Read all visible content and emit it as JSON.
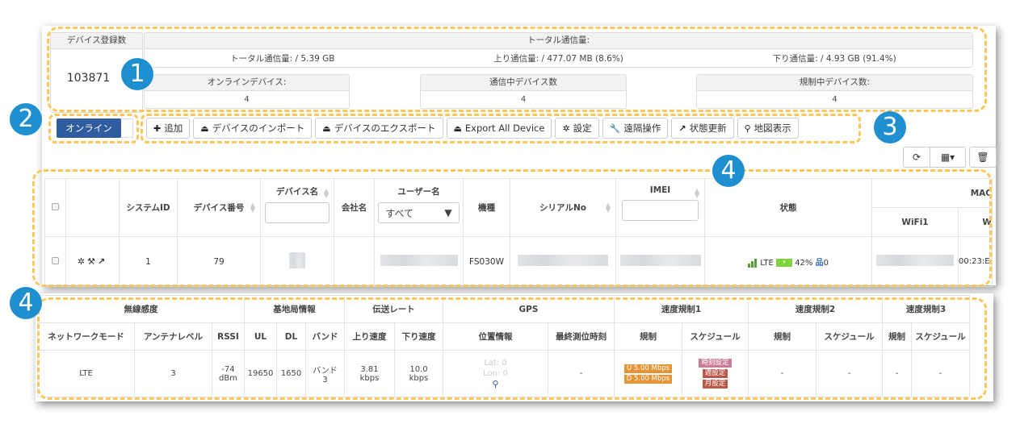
{
  "summary": {
    "registered_label": "デバイス登録数",
    "registered_value": "103871",
    "traffic_header": "トータル通信量:",
    "total": "トータル通信量: / 5.39 GB",
    "upload": "上り通信量: / 477.07 MB (8.6%)",
    "download": "下り通信量: / 4.93 GB (91.4%)",
    "online_label": "オンラインデバイス:",
    "online_value": "4",
    "communicating_label": "通信中デバイス数",
    "communicating_value": "4",
    "throttled_label": "規制中デバイス数:",
    "throttled_value": "4"
  },
  "filter": {
    "online_label": "オンライン"
  },
  "toolbar": [
    {
      "icon": "plus-icon",
      "glyph": "✚",
      "label": "追加"
    },
    {
      "icon": "import-icon",
      "glyph": "⏏",
      "label": "デバイスのインポート"
    },
    {
      "icon": "export-icon",
      "glyph": "⏏",
      "label": "デバイスのエクスポート"
    },
    {
      "icon": "export-all-icon",
      "glyph": "⏏",
      "label": "Export All Device"
    },
    {
      "icon": "gear-icon",
      "glyph": "✲",
      "label": "設定"
    },
    {
      "icon": "wrench-icon",
      "glyph": "🔧",
      "label": "遠隔操作"
    },
    {
      "icon": "external-link-icon",
      "glyph": "↗",
      "label": "状態更新"
    },
    {
      "icon": "map-marker-icon",
      "glyph": "⚲",
      "label": "地図表示"
    }
  ],
  "table_tools": {
    "refresh": "⟳",
    "columns": "▦▾",
    "delete": "🗑"
  },
  "devices_table": {
    "headers": {
      "system_id": "システムID",
      "device_no": "デバイス番号",
      "device_name": "デバイス名",
      "company": "会社名",
      "user_name": "ユーザー名",
      "user_filter": "すべて",
      "model": "機種",
      "serial": "シリアルNo",
      "imei": "IMEI",
      "status": "状態",
      "mac": "MAC",
      "wifi1": "WiFi1",
      "wifi2_partial": "W"
    },
    "rows": [
      {
        "system_id": "1",
        "device_no": "79",
        "model": "FS030W",
        "network": "LTE",
        "battery": "42%",
        "connections": "0",
        "mac_partial": "00:23:E"
      }
    ]
  },
  "detail_table": {
    "groups": [
      "無線感度",
      "基地局情報",
      "伝送レート",
      "GPS",
      "速度規制1",
      "速度規制2",
      "速度規制3"
    ],
    "headers": [
      "ネットワークモード",
      "アンテナレベル",
      "RSSI",
      "UL",
      "DL",
      "バンド",
      "上り速度",
      "下り速度",
      "位置情報",
      "最終測位時刻",
      "規制",
      "スケジュール",
      "規制",
      "スケジュール",
      "規制",
      "スケジュール"
    ],
    "row": {
      "network_mode": "LTE",
      "antenna_level": "3",
      "rssi_value": "-74",
      "rssi_unit": "dBm",
      "ul": "19650",
      "dl": "1650",
      "band_label": "バンド",
      "band_value": "3",
      "up_speed": "3.81",
      "up_unit": "kbps",
      "down_speed": "10.0",
      "down_unit": "kbps",
      "lat": "Lat: 0",
      "lon": "Lon: 0",
      "last_fix": "-",
      "limit1_up": "U 5.00 Mbps",
      "limit1_down": "D 5.00 Mbps",
      "schedule1": [
        "時刻設定",
        "週設定",
        "月設定"
      ],
      "limit2": "-",
      "schedule2": "-",
      "limit3": "-",
      "schedule3": "-"
    }
  },
  "annotations": [
    "1",
    "2",
    "3",
    "4",
    "4"
  ]
}
